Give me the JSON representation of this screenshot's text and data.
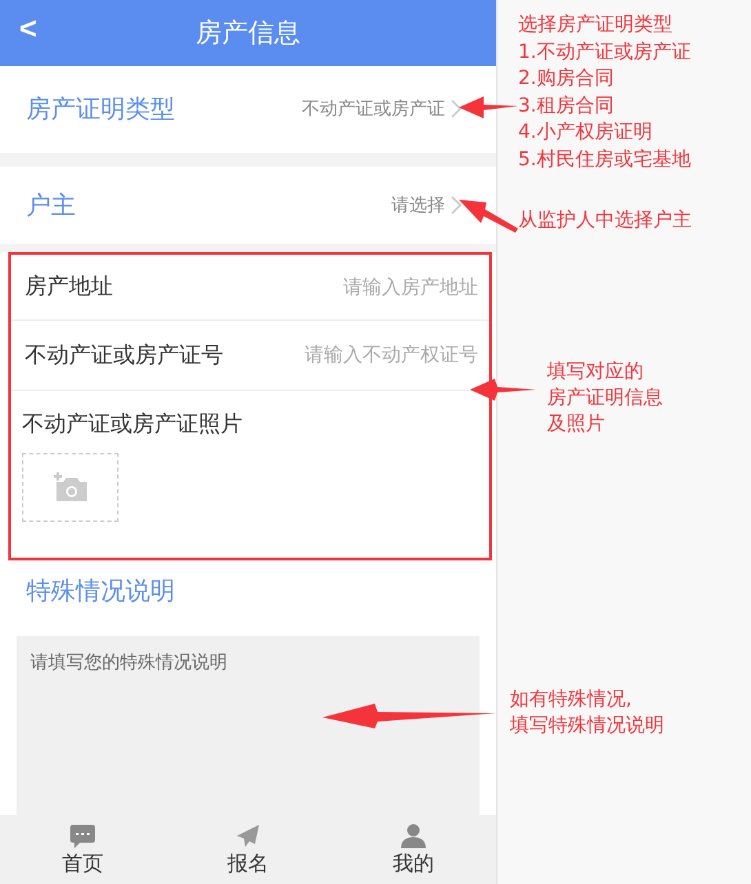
{
  "header": {
    "back": "<",
    "title": "房产信息"
  },
  "type_row": {
    "label": "房产证明类型",
    "value": "不动产证或房产证"
  },
  "owner_row": {
    "label": "户主",
    "value": "请选择"
  },
  "fields": [
    {
      "label": "房产地址",
      "placeholder": "请输入房产地址"
    },
    {
      "label": "不动产证或房产证号",
      "placeholder": "请输入不动产权证号"
    }
  ],
  "photo": {
    "label": "不动产证或房产证照片"
  },
  "special": {
    "title": "特殊情况说明",
    "placeholder": "请填写您的特殊情况说明"
  },
  "tabs": [
    {
      "label": "首页",
      "kind": "chat"
    },
    {
      "label": "报名",
      "kind": "send"
    },
    {
      "label": "我的",
      "kind": "user"
    }
  ],
  "annotations": [
    {
      "lines": [
        "选择房产证明类型",
        "1.不动产证或房产证",
        "2.购房合同",
        "3.租房合同",
        "4.小产权房证明",
        "5.村民住房或宅基地"
      ]
    },
    {
      "lines": [
        "从监护人中选择户主"
      ]
    },
    {
      "lines": [
        "填写对应的",
        "房产证明信息",
        "及照片"
      ]
    },
    {
      "lines": [
        "如有特殊情况,",
        "填写特殊情况说明"
      ]
    }
  ]
}
